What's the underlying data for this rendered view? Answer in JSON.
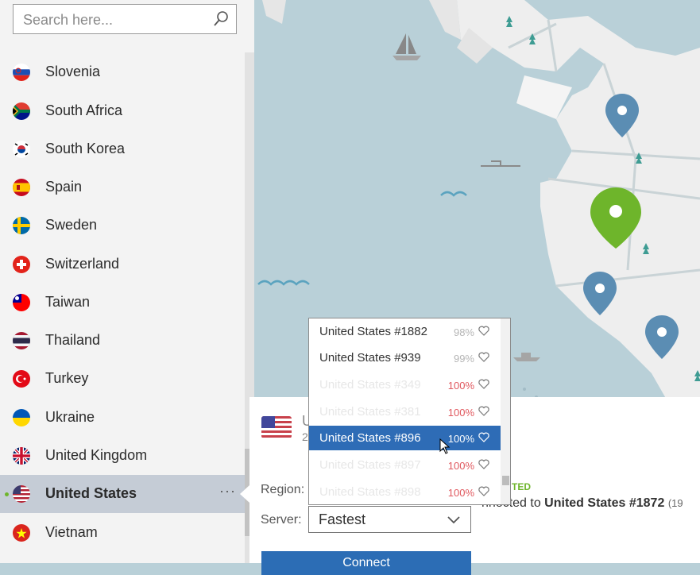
{
  "search": {
    "placeholder": "Search here..."
  },
  "countries": [
    {
      "name": "Slovenia",
      "flag": "slovenia-flag",
      "active": false
    },
    {
      "name": "South Africa",
      "flag": "south-africa-flag",
      "active": false
    },
    {
      "name": "South Korea",
      "flag": "south-korea-flag",
      "active": false
    },
    {
      "name": "Spain",
      "flag": "spain-flag",
      "active": false
    },
    {
      "name": "Sweden",
      "flag": "sweden-flag",
      "active": false
    },
    {
      "name": "Switzerland",
      "flag": "switzerland-flag",
      "active": false
    },
    {
      "name": "Taiwan",
      "flag": "taiwan-flag",
      "active": false
    },
    {
      "name": "Thailand",
      "flag": "thailand-flag",
      "active": false
    },
    {
      "name": "Turkey",
      "flag": "turkey-flag",
      "active": false
    },
    {
      "name": "Ukraine",
      "flag": "ukraine-flag",
      "active": false
    },
    {
      "name": "United Kingdom",
      "flag": "united-kingdom-flag",
      "active": false
    },
    {
      "name": "United States",
      "flag": "united-states-flag",
      "active": true,
      "more": "···"
    },
    {
      "name": "Vietnam",
      "flag": "vietnam-flag",
      "active": false
    }
  ],
  "panel": {
    "title": "U",
    "subtitle": "2",
    "region_label": "Region:",
    "server_label": "Server:",
    "server_value": "Fastest",
    "connect_label": "Connect"
  },
  "server_dropdown": {
    "options": [
      {
        "name": "United States #1882",
        "load": "98%",
        "state": "low",
        "selected": false,
        "faded": false
      },
      {
        "name": "United States #939",
        "load": "99%",
        "state": "low",
        "selected": false,
        "faded": false
      },
      {
        "name": "United States #349",
        "load": "100%",
        "state": "high",
        "selected": false,
        "faded": true
      },
      {
        "name": "United States #381",
        "load": "100%",
        "state": "high",
        "selected": false,
        "faded": true
      },
      {
        "name": "United States #896",
        "load": "100%",
        "state": "high",
        "selected": true,
        "faded": false
      },
      {
        "name": "United States #897",
        "load": "100%",
        "state": "high",
        "selected": false,
        "faded": true
      },
      {
        "name": "United States #898",
        "load": "100%",
        "state": "high",
        "selected": false,
        "faded": true
      }
    ]
  },
  "status": {
    "title": "TED",
    "line_prefix": "nnected to ",
    "server": "United States #1872",
    "ip": "(19"
  },
  "colors": {
    "accent_blue": "#2e6cb6",
    "connected_green": "#6eb52b",
    "load_red": "#e0585e",
    "pin_blue": "#5b8db3"
  }
}
